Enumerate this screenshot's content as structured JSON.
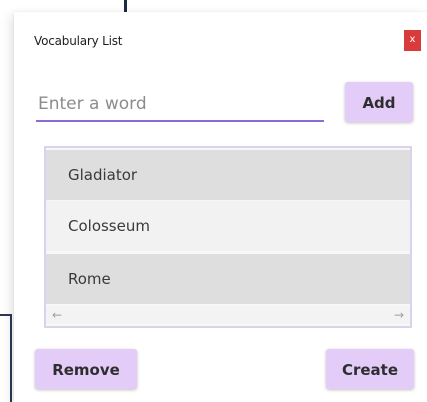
{
  "window": {
    "title": "Vocabulary List",
    "close_label": "x"
  },
  "input": {
    "placeholder": "Enter a word",
    "value": ""
  },
  "buttons": {
    "add": "Add",
    "remove": "Remove",
    "create": "Create"
  },
  "list": {
    "items": [
      "Gladiator",
      "Colosseum",
      "Rome"
    ],
    "scroll_left_icon": "arrow-left-icon",
    "scroll_right_icon": "arrow-right-icon"
  },
  "colors": {
    "accent": "#8d6ad6",
    "button_bg": "#e3ccf7",
    "close_bg": "#d93a3a"
  }
}
